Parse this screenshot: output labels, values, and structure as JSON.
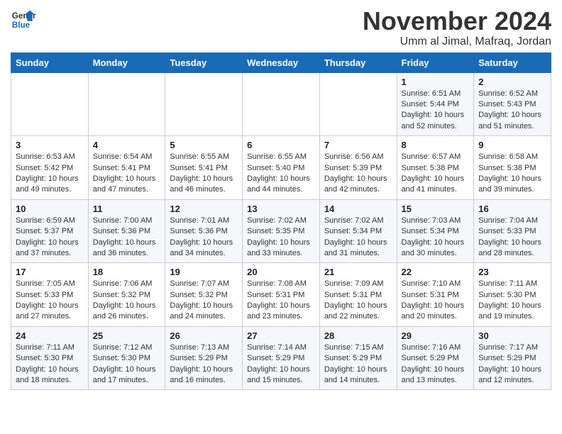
{
  "header": {
    "logo_line1": "General",
    "logo_line2": "Blue",
    "month_title": "November 2024",
    "location": "Umm al Jimal, Mafraq, Jordan"
  },
  "weekdays": [
    "Sunday",
    "Monday",
    "Tuesday",
    "Wednesday",
    "Thursday",
    "Friday",
    "Saturday"
  ],
  "weeks": [
    [
      {
        "day": "",
        "info": ""
      },
      {
        "day": "",
        "info": ""
      },
      {
        "day": "",
        "info": ""
      },
      {
        "day": "",
        "info": ""
      },
      {
        "day": "",
        "info": ""
      },
      {
        "day": "1",
        "info": "Sunrise: 6:51 AM\nSunset: 5:44 PM\nDaylight: 10 hours\nand 52 minutes."
      },
      {
        "day": "2",
        "info": "Sunrise: 6:52 AM\nSunset: 5:43 PM\nDaylight: 10 hours\nand 51 minutes."
      }
    ],
    [
      {
        "day": "3",
        "info": "Sunrise: 6:53 AM\nSunset: 5:42 PM\nDaylight: 10 hours\nand 49 minutes."
      },
      {
        "day": "4",
        "info": "Sunrise: 6:54 AM\nSunset: 5:41 PM\nDaylight: 10 hours\nand 47 minutes."
      },
      {
        "day": "5",
        "info": "Sunrise: 6:55 AM\nSunset: 5:41 PM\nDaylight: 10 hours\nand 46 minutes."
      },
      {
        "day": "6",
        "info": "Sunrise: 6:55 AM\nSunset: 5:40 PM\nDaylight: 10 hours\nand 44 minutes."
      },
      {
        "day": "7",
        "info": "Sunrise: 6:56 AM\nSunset: 5:39 PM\nDaylight: 10 hours\nand 42 minutes."
      },
      {
        "day": "8",
        "info": "Sunrise: 6:57 AM\nSunset: 5:38 PM\nDaylight: 10 hours\nand 41 minutes."
      },
      {
        "day": "9",
        "info": "Sunrise: 6:58 AM\nSunset: 5:38 PM\nDaylight: 10 hours\nand 39 minutes."
      }
    ],
    [
      {
        "day": "10",
        "info": "Sunrise: 6:59 AM\nSunset: 5:37 PM\nDaylight: 10 hours\nand 37 minutes."
      },
      {
        "day": "11",
        "info": "Sunrise: 7:00 AM\nSunset: 5:36 PM\nDaylight: 10 hours\nand 36 minutes."
      },
      {
        "day": "12",
        "info": "Sunrise: 7:01 AM\nSunset: 5:36 PM\nDaylight: 10 hours\nand 34 minutes."
      },
      {
        "day": "13",
        "info": "Sunrise: 7:02 AM\nSunset: 5:35 PM\nDaylight: 10 hours\nand 33 minutes."
      },
      {
        "day": "14",
        "info": "Sunrise: 7:02 AM\nSunset: 5:34 PM\nDaylight: 10 hours\nand 31 minutes."
      },
      {
        "day": "15",
        "info": "Sunrise: 7:03 AM\nSunset: 5:34 PM\nDaylight: 10 hours\nand 30 minutes."
      },
      {
        "day": "16",
        "info": "Sunrise: 7:04 AM\nSunset: 5:33 PM\nDaylight: 10 hours\nand 28 minutes."
      }
    ],
    [
      {
        "day": "17",
        "info": "Sunrise: 7:05 AM\nSunset: 5:33 PM\nDaylight: 10 hours\nand 27 minutes."
      },
      {
        "day": "18",
        "info": "Sunrise: 7:06 AM\nSunset: 5:32 PM\nDaylight: 10 hours\nand 26 minutes."
      },
      {
        "day": "19",
        "info": "Sunrise: 7:07 AM\nSunset: 5:32 PM\nDaylight: 10 hours\nand 24 minutes."
      },
      {
        "day": "20",
        "info": "Sunrise: 7:08 AM\nSunset: 5:31 PM\nDaylight: 10 hours\nand 23 minutes."
      },
      {
        "day": "21",
        "info": "Sunrise: 7:09 AM\nSunset: 5:31 PM\nDaylight: 10 hours\nand 22 minutes."
      },
      {
        "day": "22",
        "info": "Sunrise: 7:10 AM\nSunset: 5:31 PM\nDaylight: 10 hours\nand 20 minutes."
      },
      {
        "day": "23",
        "info": "Sunrise: 7:11 AM\nSunset: 5:30 PM\nDaylight: 10 hours\nand 19 minutes."
      }
    ],
    [
      {
        "day": "24",
        "info": "Sunrise: 7:11 AM\nSunset: 5:30 PM\nDaylight: 10 hours\nand 18 minutes."
      },
      {
        "day": "25",
        "info": "Sunrise: 7:12 AM\nSunset: 5:30 PM\nDaylight: 10 hours\nand 17 minutes."
      },
      {
        "day": "26",
        "info": "Sunrise: 7:13 AM\nSunset: 5:29 PM\nDaylight: 10 hours\nand 16 minutes."
      },
      {
        "day": "27",
        "info": "Sunrise: 7:14 AM\nSunset: 5:29 PM\nDaylight: 10 hours\nand 15 minutes."
      },
      {
        "day": "28",
        "info": "Sunrise: 7:15 AM\nSunset: 5:29 PM\nDaylight: 10 hours\nand 14 minutes."
      },
      {
        "day": "29",
        "info": "Sunrise: 7:16 AM\nSunset: 5:29 PM\nDaylight: 10 hours\nand 13 minutes."
      },
      {
        "day": "30",
        "info": "Sunrise: 7:17 AM\nSunset: 5:29 PM\nDaylight: 10 hours\nand 12 minutes."
      }
    ]
  ]
}
